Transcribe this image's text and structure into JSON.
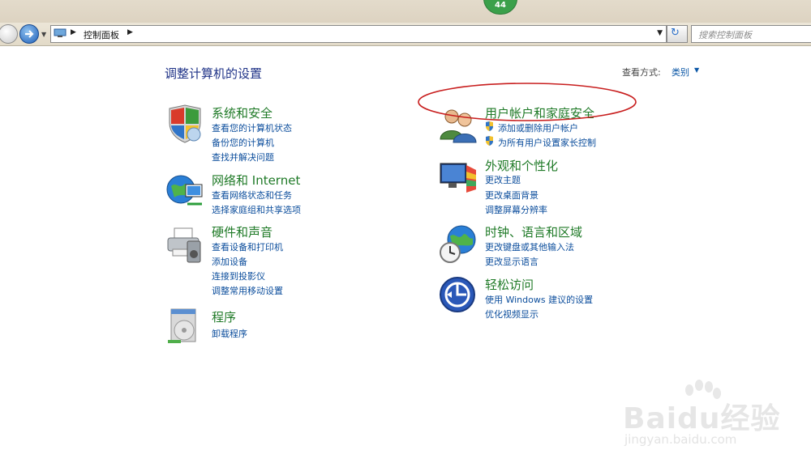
{
  "titlebar": {
    "badge": "44",
    "right_left": "搜索控制面板",
    "right_right": "控制面板"
  },
  "navbar": {
    "address": "控制面板",
    "search_placeholder": "搜索控制面板"
  },
  "heading": "调整计算机的设置",
  "view_by": {
    "label": "查看方式:",
    "value": "类别"
  },
  "categories": [
    {
      "title": "系统和安全",
      "icon": "shield-icon",
      "links": [
        "查看您的计算机状态",
        "备份您的计算机",
        "查找并解决问题"
      ]
    },
    {
      "title": "网络和 Internet",
      "icon": "network-globe-icon",
      "links": [
        "查看网络状态和任务",
        "选择家庭组和共享选项"
      ]
    },
    {
      "title": "硬件和声音",
      "icon": "printer-icon",
      "links": [
        "查看设备和打印机",
        "添加设备",
        "连接到投影仪",
        "调整常用移动设置"
      ]
    },
    {
      "title": "程序",
      "icon": "programs-icon",
      "links": [
        "卸载程序"
      ]
    },
    {
      "title": "用户帐户和家庭安全",
      "icon": "users-icon",
      "links": [
        "添加或删除用户帐户",
        "为所有用户设置家长控制"
      ]
    },
    {
      "title": "外观和个性化",
      "icon": "monitor-palette-icon",
      "links": [
        "更改主题",
        "更改桌面背景",
        "调整屏幕分辨率"
      ]
    },
    {
      "title": "时钟、语言和区域",
      "icon": "clock-globe-icon",
      "links": [
        "更改键盘或其他输入法",
        "更改显示语言"
      ]
    },
    {
      "title": "轻松访问",
      "icon": "ease-of-access-icon",
      "links": [
        "使用 Windows 建议的设置",
        "优化视频显示"
      ]
    }
  ],
  "watermark": {
    "text": "Baidu经验",
    "sub": "jingyan.baidu.com"
  },
  "colors": {
    "category_title": "#1f7a27",
    "link": "#0b4d9c",
    "heading": "#1e3287",
    "annotation_ellipse": "#c81e1e"
  }
}
